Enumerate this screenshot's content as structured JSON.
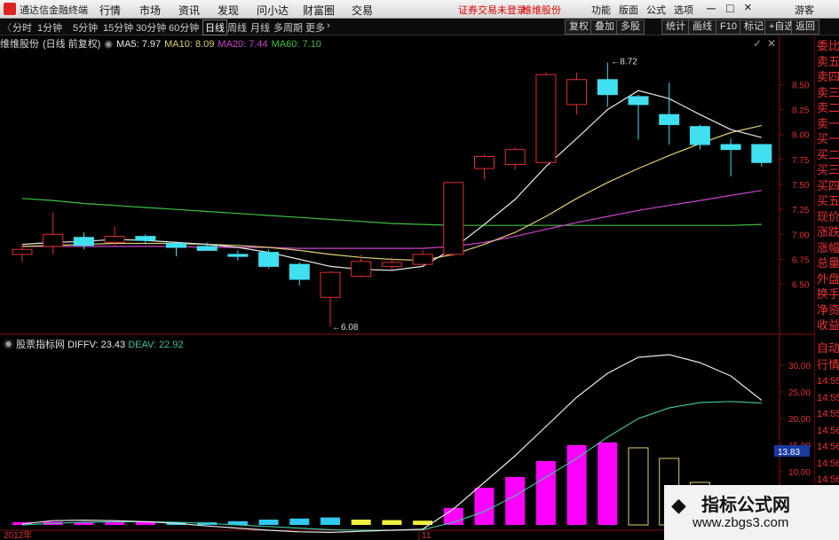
{
  "titlebar": {
    "app_name": "通达信金融终端",
    "menu": [
      "行情",
      "市场",
      "资讯",
      "发现",
      "问小达",
      "财富圈",
      "交易"
    ],
    "notice": "证券交易未登录",
    "notice2": "维维股份",
    "right_menu": [
      "功能",
      "版面",
      "公式",
      "选项"
    ],
    "user": "游客"
  },
  "toolbar": {
    "periods": [
      "分时",
      "1分钟",
      "5分钟",
      "15分钟",
      "30分钟",
      "60分钟",
      "日线",
      "周线",
      "月线",
      "多周期",
      "更多"
    ],
    "active_period": "日线",
    "buttons": [
      "复权",
      "叠加",
      "多股",
      "统计",
      "画线",
      "F10",
      "标记",
      "+自选",
      "返回"
    ]
  },
  "main_info": {
    "stock": "维维股份",
    "mode": "(日线 前复权)",
    "ma5": "MA5: 7.97",
    "ma10": "MA10: 8.09",
    "ma20": "MA20: 7.44",
    "ma60": "MA60: 7.10"
  },
  "sub_info": {
    "name": "股票指标网",
    "diffv": "DIFFV: 23.43",
    "deav": "DEAV: 22.92"
  },
  "right_col": {
    "upper": [
      "委比",
      "卖五",
      "卖四",
      "卖三",
      "卖二",
      "卖一",
      "买一",
      "买二",
      "买三",
      "买四",
      "买五",
      "现价",
      "涨跌",
      "涨幅",
      "总量",
      "外盘",
      "换手",
      "净资",
      "收益"
    ],
    "lower": [
      "自动",
      "行情",
      "14:55",
      "14:55",
      "14:55",
      "14:56",
      "14:56",
      "14:56",
      "14:56",
      "14:56"
    ]
  },
  "price_axis": [
    "8.50",
    "8.25",
    "8.00",
    "7.75",
    "7.50",
    "7.25",
    "7.00",
    "6.75",
    "6.50"
  ],
  "sub_axis": [
    "30.00",
    "25.00",
    "20.00",
    "15.00",
    "10.00",
    "5.00"
  ],
  "sub_current": "13.83",
  "date_labels": [
    "2012年",
    "11"
  ],
  "annotations": {
    "high": "8.72",
    "low": "6.08"
  },
  "watermark": {
    "line1": "指标公式网",
    "line2": "www.zbgs3.com"
  },
  "colors": {
    "up": "#e03030",
    "down": "#40e0f0",
    "ma5": "#e8e8e8",
    "ma10": "#e0d070",
    "ma20": "#cc44cc",
    "ma60": "#40c040",
    "diff": "#e8e8e8",
    "dea": "#40c0a0",
    "bar_up": "#ff00ff",
    "bar_y": "#f0f040",
    "bar_c": "#30c8f0"
  },
  "chart_data": {
    "type": "candlestick",
    "ylim": [
      6.0,
      8.85
    ],
    "candles": [
      {
        "o": 6.8,
        "h": 6.9,
        "l": 6.72,
        "c": 6.85
      },
      {
        "o": 6.88,
        "h": 7.22,
        "l": 6.8,
        "c": 7.0
      },
      {
        "o": 6.97,
        "h": 7.02,
        "l": 6.85,
        "c": 6.89
      },
      {
        "o": 6.92,
        "h": 7.08,
        "l": 6.88,
        "c": 6.98
      },
      {
        "o": 6.98,
        "h": 7.0,
        "l": 6.9,
        "c": 6.94
      },
      {
        "o": 6.91,
        "h": 6.92,
        "l": 6.78,
        "c": 6.87
      },
      {
        "o": 6.88,
        "h": 6.92,
        "l": 6.84,
        "c": 6.84
      },
      {
        "o": 6.8,
        "h": 6.84,
        "l": 6.74,
        "c": 6.78
      },
      {
        "o": 6.82,
        "h": 6.85,
        "l": 6.66,
        "c": 6.68
      },
      {
        "o": 6.7,
        "h": 6.72,
        "l": 6.49,
        "c": 6.55
      },
      {
        "o": 6.37,
        "h": 6.63,
        "l": 6.08,
        "c": 6.62
      },
      {
        "o": 6.58,
        "h": 6.8,
        "l": 6.57,
        "c": 6.73
      },
      {
        "o": 6.68,
        "h": 6.77,
        "l": 6.65,
        "c": 6.72
      },
      {
        "o": 6.7,
        "h": 6.84,
        "l": 6.69,
        "c": 6.8
      },
      {
        "o": 6.8,
        "h": 7.52,
        "l": 6.78,
        "c": 7.52
      },
      {
        "o": 7.66,
        "h": 7.8,
        "l": 7.55,
        "c": 7.78
      },
      {
        "o": 7.7,
        "h": 7.87,
        "l": 7.65,
        "c": 7.85
      },
      {
        "o": 7.72,
        "h": 8.62,
        "l": 7.72,
        "c": 8.6
      },
      {
        "o": 8.3,
        "h": 8.62,
        "l": 8.2,
        "c": 8.55
      },
      {
        "o": 8.55,
        "h": 8.72,
        "l": 8.28,
        "c": 8.4
      },
      {
        "o": 8.38,
        "h": 8.4,
        "l": 7.95,
        "c": 8.3
      },
      {
        "o": 8.2,
        "h": 8.52,
        "l": 7.9,
        "c": 8.1
      },
      {
        "o": 8.08,
        "h": 8.1,
        "l": 7.85,
        "c": 7.9
      },
      {
        "o": 7.9,
        "h": 7.96,
        "l": 7.58,
        "c": 7.85
      },
      {
        "o": 7.9,
        "h": 7.9,
        "l": 7.68,
        "c": 7.72
      }
    ],
    "ma5": [
      6.9,
      6.92,
      6.93,
      6.95,
      6.94,
      6.92,
      6.9,
      6.87,
      6.82,
      6.75,
      6.68,
      6.65,
      6.64,
      6.68,
      6.86,
      7.1,
      7.35,
      7.68,
      7.96,
      8.25,
      8.44,
      8.36,
      8.2,
      8.05,
      7.97
    ],
    "ma10": [
      6.88,
      6.89,
      6.9,
      6.91,
      6.91,
      6.91,
      6.9,
      6.89,
      6.87,
      6.84,
      6.8,
      6.77,
      6.75,
      6.74,
      6.8,
      6.9,
      7.02,
      7.18,
      7.36,
      7.52,
      7.66,
      7.79,
      7.91,
      8.02,
      8.09
    ],
    "ma20": [
      6.88,
      6.88,
      6.88,
      6.88,
      6.88,
      6.88,
      6.87,
      6.87,
      6.87,
      6.86,
      6.86,
      6.86,
      6.86,
      6.86,
      6.88,
      6.92,
      6.98,
      7.05,
      7.12,
      7.18,
      7.24,
      7.29,
      7.34,
      7.39,
      7.44
    ],
    "ma60": [
      7.36,
      7.34,
      7.31,
      7.29,
      7.27,
      7.25,
      7.23,
      7.21,
      7.19,
      7.17,
      7.15,
      7.13,
      7.11,
      7.1,
      7.09,
      7.09,
      7.09,
      7.09,
      7.09,
      7.09,
      7.09,
      7.09,
      7.09,
      7.09,
      7.1
    ],
    "sub": {
      "ylim": [
        0,
        33
      ],
      "bars": [
        0.4,
        0.6,
        0.5,
        0.7,
        0.6,
        0.3,
        -0.4,
        -0.7,
        -1.0,
        -1.2,
        -1.4,
        -1.0,
        -0.9,
        -0.8,
        3.2,
        7.0,
        9.0,
        12.0,
        15.0,
        15.5,
        14.5,
        12.5,
        8.0,
        3.5,
        2.0
      ],
      "bar_colors": [
        "m",
        "m",
        "m",
        "m",
        "m",
        "c",
        "c",
        "c",
        "c",
        "c",
        "c",
        "y",
        "y",
        "y",
        "m",
        "m",
        "m",
        "m",
        "m",
        "m",
        "o",
        "o",
        "o",
        "o",
        "o"
      ],
      "diff": [
        0.2,
        0.8,
        0.9,
        0.8,
        0.6,
        0.3,
        -0.2,
        -0.6,
        -1.0,
        -1.3,
        -1.4,
        -1.2,
        -1.0,
        -0.8,
        3.0,
        8.0,
        13.0,
        18.5,
        24.0,
        28.5,
        31.5,
        32.0,
        30.5,
        28.0,
        23.43
      ],
      "dea": [
        0.0,
        0.3,
        0.5,
        0.6,
        0.6,
        0.5,
        0.3,
        0.0,
        -0.3,
        -0.6,
        -0.9,
        -1.0,
        -1.0,
        -0.9,
        0.5,
        2.5,
        5.5,
        9.0,
        12.5,
        16.5,
        20.0,
        22.0,
        23.0,
        23.2,
        22.92
      ]
    }
  }
}
